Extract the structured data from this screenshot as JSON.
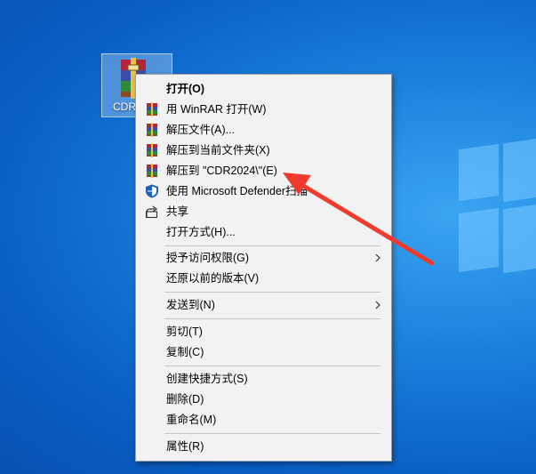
{
  "desktop": {
    "icon_label": "CDR"
  },
  "menu": {
    "items": [
      {
        "label": "打开(O)",
        "icon": "",
        "bold": true
      },
      {
        "label": "用 WinRAR 打开(W)",
        "icon": "winrar-icon"
      },
      {
        "label": "解压文件(A)...",
        "icon": "winrar-icon"
      },
      {
        "label": "解压到当前文件夹(X)",
        "icon": "winrar-icon"
      },
      {
        "label": "解压到 \"CDR2024\\\"(E)",
        "icon": "winrar-icon"
      },
      {
        "label": "使用 Microsoft Defender扫描",
        "icon": "defender-shield-icon"
      },
      {
        "label": "共享",
        "icon": "share-icon"
      },
      {
        "label": "打开方式(H)...",
        "icon": ""
      },
      {
        "label": "授予访问权限(G)",
        "icon": "",
        "submenu": true
      },
      {
        "label": "还原以前的版本(V)",
        "icon": ""
      },
      {
        "label": "发送到(N)",
        "icon": "",
        "submenu": true
      },
      {
        "label": "剪切(T)",
        "icon": ""
      },
      {
        "label": "复制(C)",
        "icon": ""
      },
      {
        "label": "创建快捷方式(S)",
        "icon": ""
      },
      {
        "label": "删除(D)",
        "icon": ""
      },
      {
        "label": "重命名(M)",
        "icon": ""
      },
      {
        "label": "属性(R)",
        "icon": ""
      }
    ]
  },
  "annotation": {
    "arrow_color": "#f03a2e",
    "points_to": "解压到 \"CDR2024\\\"(E)"
  }
}
